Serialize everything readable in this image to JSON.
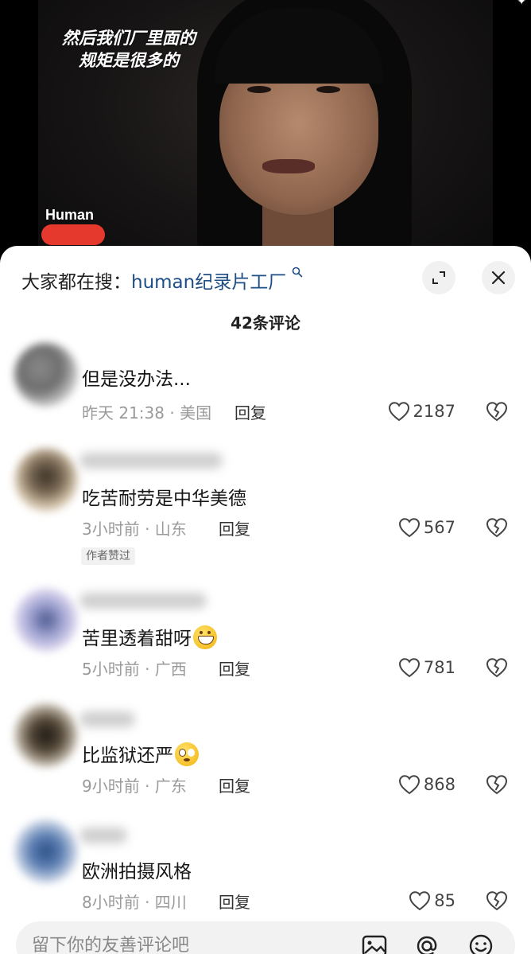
{
  "video": {
    "caption_line1": "然后我们厂里面的",
    "caption_line2": "规矩是很多的",
    "brand": "Human",
    "corner_mark": "✦"
  },
  "sheet": {
    "search_prefix": "大家都在搜：",
    "search_term": "human纪录片工厂",
    "search_icon": "search-icon",
    "comment_count": "42条评论"
  },
  "comments": [
    {
      "text": "但是没办法...",
      "time_location": "昨天 21:38 · 美国",
      "reply": "回复",
      "likes": "2187"
    },
    {
      "text": "吃苦耐劳是中华美德",
      "time_location": "3小时前 · 山东",
      "reply": "回复",
      "likes": "567",
      "badge": "作者赞过"
    },
    {
      "text": "苦里透着甜呀",
      "emoji": "grinning-face",
      "time_location": "5小时前 · 广西",
      "reply": "回复",
      "likes": "781"
    },
    {
      "text": "比监狱还严",
      "emoji": "flushed-face",
      "time_location": "9小时前 · 广东",
      "reply": "回复",
      "likes": "868"
    },
    {
      "text": "欧洲拍摄风格",
      "time_location": "8小时前 · 四川",
      "reply": "回复",
      "likes": "85"
    }
  ],
  "input": {
    "placeholder": "留下你的友善评论吧"
  },
  "colors": {
    "link": "#1f4e86",
    "redaction": "#e6392e",
    "meta_gray": "#9a9a9a"
  }
}
